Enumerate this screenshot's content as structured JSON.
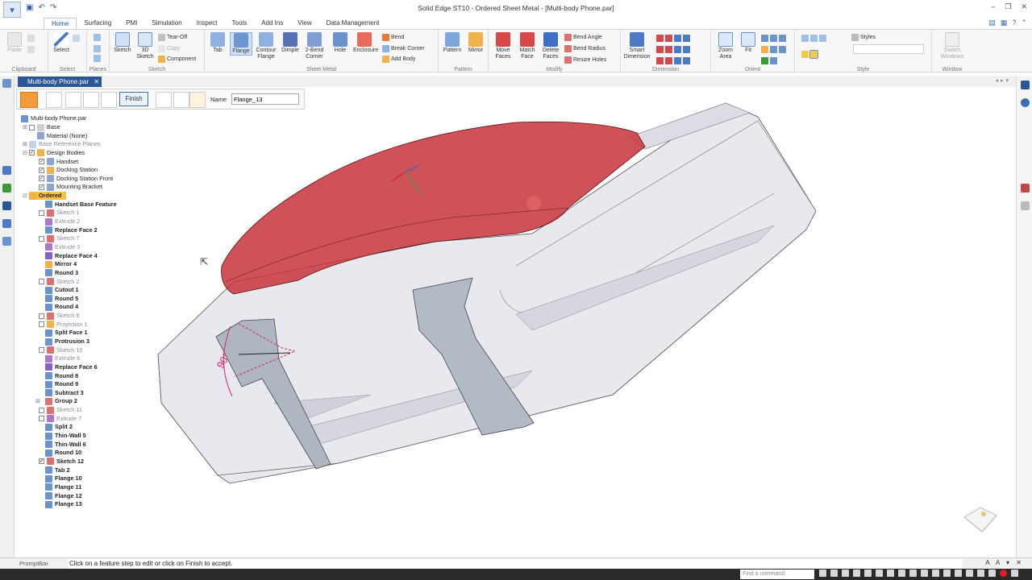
{
  "window": {
    "title": "Solid Edge ST10 - Ordered Sheet Metal - [Multi-body Phone.par]"
  },
  "tabs": [
    "Home",
    "Surfacing",
    "PMI",
    "Simulation",
    "Inspect",
    "Tools",
    "Add Ins",
    "View",
    "Data Management"
  ],
  "ribbon": {
    "groups": {
      "clipboard": "Clipboard",
      "select": "Select",
      "planes": "Planes",
      "sketch": "Sketch",
      "sheet_metal": "Sheet Metal",
      "pattern": "Pattern",
      "modify": "Modify",
      "dimension": "Dimension",
      "orient": "Orient",
      "style": "Style",
      "window": "Window"
    },
    "buttons": {
      "paste": "Paste",
      "select": "Select",
      "sketch": "Sketch",
      "sketch3d": "3D Sketch",
      "tear_off": "Tear-Off",
      "copy": "Copy",
      "component": "Component",
      "tab": "Tab",
      "flange": "Flange",
      "contour_flange": "Contour Flange",
      "dimple": "Dimple",
      "bend_corner": "2-Bend Corner",
      "hole": "Hole",
      "enclosure": "Enclosure",
      "bend": "Bend",
      "break_corner": "Break Corner",
      "add_body": "Add Body",
      "pattern": "Pattern",
      "mirror": "Mirror",
      "move_faces": "Move Faces",
      "match_face": "Match Face",
      "delete_faces": "Delete Faces",
      "bend_angle": "Bend Angle",
      "bend_radius": "Bend Radius",
      "resize_holes": "Resize Holes",
      "smart_dimension": "Smart Dimension",
      "zoom_area": "Zoom Area",
      "fit": "Fit",
      "styles": "Styles",
      "switch_windows": "Switch Windows"
    }
  },
  "document_tab": {
    "label": "Multi-body Phone.par",
    "close": "✕"
  },
  "command_bar": {
    "finish": "Finish",
    "name_label": "Name",
    "name_value": "Flange_13"
  },
  "tree": {
    "root": "Multi-body Phone.par",
    "items": [
      {
        "label": "Base"
      },
      {
        "label": "Material (None)"
      },
      {
        "label": "Base Reference Planes"
      },
      {
        "label": "Design Bodies"
      },
      {
        "label": "Handset"
      },
      {
        "label": "Docking Station"
      },
      {
        "label": "Docking Station Front"
      },
      {
        "label": "Mounting Bracket"
      },
      {
        "label": "Ordered"
      },
      {
        "label": "Handset Base Feature"
      },
      {
        "label": "Sketch 1"
      },
      {
        "label": "Extrude 2"
      },
      {
        "label": "Replace Face 2"
      },
      {
        "label": "Sketch 7"
      },
      {
        "label": "Extrude 3"
      },
      {
        "label": "Replace Face 4"
      },
      {
        "label": "Mirror 4"
      },
      {
        "label": "Round 3"
      },
      {
        "label": "Sketch 2"
      },
      {
        "label": "Cutout 1"
      },
      {
        "label": "Round 5"
      },
      {
        "label": "Round 4"
      },
      {
        "label": "Sketch 9"
      },
      {
        "label": "Projection 1"
      },
      {
        "label": "Split Face 1"
      },
      {
        "label": "Protrusion 3"
      },
      {
        "label": "Sketch 10"
      },
      {
        "label": "Extrude 6"
      },
      {
        "label": "Replace Face 6"
      },
      {
        "label": "Round 8"
      },
      {
        "label": "Round 9"
      },
      {
        "label": "Subtract 3"
      },
      {
        "label": "Group 2"
      },
      {
        "label": "Sketch 11"
      },
      {
        "label": "Extrude 7"
      },
      {
        "label": "Split 2"
      },
      {
        "label": "Thin-Wall 5"
      },
      {
        "label": "Thin-Wall 6"
      },
      {
        "label": "Round 10"
      },
      {
        "label": "Sketch 12"
      },
      {
        "label": "Tab 2"
      },
      {
        "label": "Flange 10"
      },
      {
        "label": "Flange 11"
      },
      {
        "label": "Flange 12"
      },
      {
        "label": "Flange 13"
      }
    ]
  },
  "viewport": {
    "dimension_label": "90°"
  },
  "statusbar": {
    "promptbar_label": "PromptBar",
    "message": "Click on a feature step to edit or click on Finish to accept.",
    "find_placeholder": "Find a command",
    "text_size": "A A"
  },
  "colors": {
    "accent": "#2b5797",
    "highlight": "#f5c242",
    "handset": "#c8343c",
    "sketch": "#e0206a"
  },
  "icons": [
    "app-menu-icon",
    "save-icon",
    "undo-icon",
    "redo-icon",
    "help-icon",
    "facebook-icon",
    "close-icon"
  ]
}
